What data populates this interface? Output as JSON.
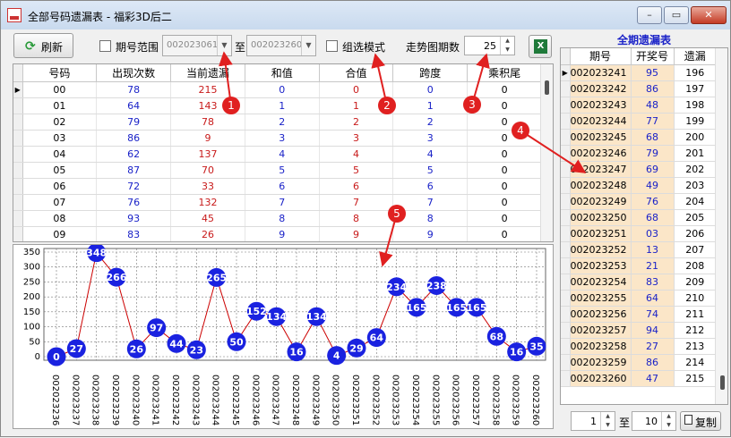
{
  "window": {
    "title": "全部号码遗漏表 - 福彩3D后二",
    "min_label": "–",
    "max_label": "▭",
    "close_label": "✕"
  },
  "toolbar": {
    "refresh_label": "刷新",
    "refresh_icon": "refresh-icon",
    "period_range_label": "期号范围",
    "period_from": "002023061",
    "to_label": "至",
    "period_to": "002023260",
    "group_mode_label": "组选模式",
    "trend_periods_label": "走势图期数",
    "trend_periods_value": "25",
    "excel_label": "X"
  },
  "table": {
    "headers": [
      "号码",
      "出现次数",
      "当前遗漏",
      "和值",
      "合值",
      "跨度",
      "乘积尾"
    ],
    "rows": [
      [
        "00",
        "78",
        "215",
        "0",
        "0",
        "0",
        "0"
      ],
      [
        "01",
        "64",
        "143",
        "1",
        "1",
        "1",
        "0"
      ],
      [
        "02",
        "79",
        "78",
        "2",
        "2",
        "2",
        "0"
      ],
      [
        "03",
        "86",
        "9",
        "3",
        "3",
        "3",
        "0"
      ],
      [
        "04",
        "62",
        "137",
        "4",
        "4",
        "4",
        "0"
      ],
      [
        "05",
        "87",
        "70",
        "5",
        "5",
        "5",
        "0"
      ],
      [
        "06",
        "72",
        "33",
        "6",
        "6",
        "6",
        "0"
      ],
      [
        "07",
        "76",
        "132",
        "7",
        "7",
        "7",
        "0"
      ],
      [
        "08",
        "93",
        "45",
        "8",
        "8",
        "8",
        "0"
      ],
      [
        "09",
        "83",
        "26",
        "9",
        "9",
        "9",
        "0"
      ]
    ]
  },
  "annotations": [
    "1",
    "2",
    "3",
    "4",
    "5"
  ],
  "chart_data": {
    "type": "line",
    "x": [
      "002023236",
      "002023237",
      "002023238",
      "002023239",
      "002023240",
      "002023241",
      "002023242",
      "002023243",
      "002023244",
      "002023245",
      "002023246",
      "002023247",
      "002023248",
      "002023249",
      "002023250",
      "002023251",
      "002023252",
      "002023253",
      "002023254",
      "002023255",
      "002023256",
      "002023257",
      "002023258",
      "002023259",
      "002023260"
    ],
    "values": [
      0,
      27,
      348,
      266,
      26,
      97,
      44,
      23,
      265,
      50,
      152,
      134,
      16,
      134,
      4,
      29,
      64,
      234,
      165,
      238,
      165,
      165,
      68,
      16,
      35
    ],
    "yticks": [
      "0",
      "25",
      "50",
      "75",
      "100",
      "125",
      "150",
      "175",
      "200",
      "225",
      "250",
      "275",
      "300",
      "325",
      "350"
    ],
    "ylim": [
      0,
      350
    ],
    "grid": true,
    "line_color": "#cc0000",
    "marker_color": "#1a22e0"
  },
  "right_panel": {
    "title": "全期遗漏表",
    "headers": [
      "期号",
      "开奖号",
      "遗漏"
    ],
    "rows": [
      [
        "002023241",
        "95",
        "196"
      ],
      [
        "002023242",
        "86",
        "197"
      ],
      [
        "002023243",
        "48",
        "198"
      ],
      [
        "002023244",
        "77",
        "199"
      ],
      [
        "002023245",
        "68",
        "200"
      ],
      [
        "002023246",
        "79",
        "201"
      ],
      [
        "002023247",
        "69",
        "202"
      ],
      [
        "002023248",
        "49",
        "203"
      ],
      [
        "002023249",
        "76",
        "204"
      ],
      [
        "002023250",
        "68",
        "205"
      ],
      [
        "002023251",
        "03",
        "206"
      ],
      [
        "002023252",
        "13",
        "207"
      ],
      [
        "002023253",
        "21",
        "208"
      ],
      [
        "002023254",
        "83",
        "209"
      ],
      [
        "002023255",
        "64",
        "210"
      ],
      [
        "002023256",
        "74",
        "211"
      ],
      [
        "002023257",
        "94",
        "212"
      ],
      [
        "002023258",
        "27",
        "213"
      ],
      [
        "002023259",
        "86",
        "214"
      ],
      [
        "002023260",
        "47",
        "215"
      ]
    ],
    "bottom": {
      "from": "1",
      "to_label": "至",
      "to": "10",
      "copy_label": "复制",
      "copy_icon": "copy-icon"
    }
  }
}
